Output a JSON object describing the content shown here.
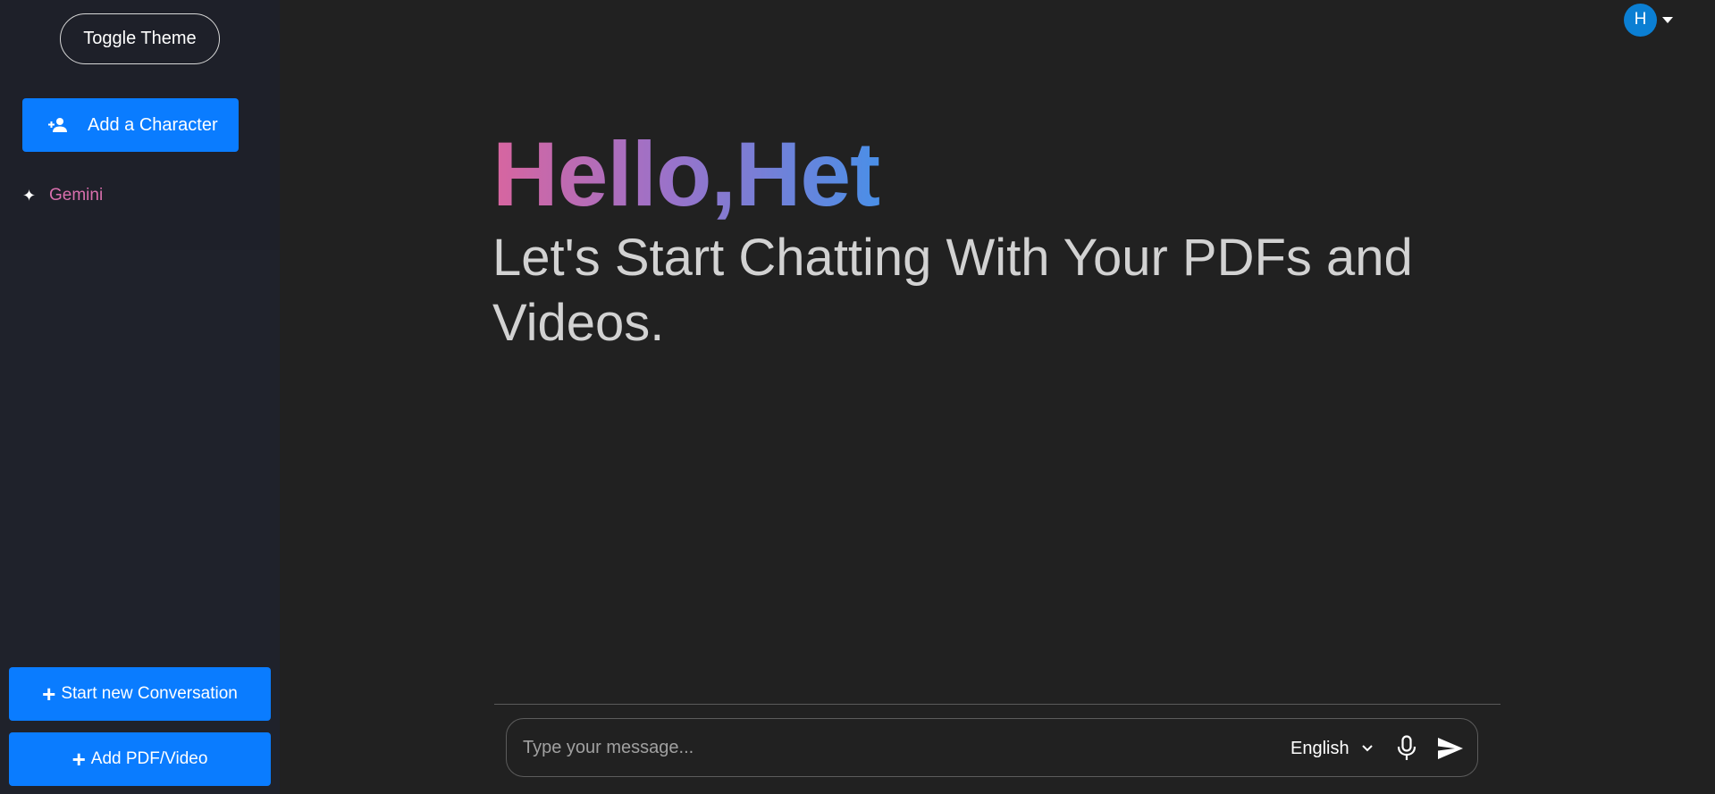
{
  "sidebar": {
    "toggle_theme_label": "Toggle Theme",
    "add_character_label": "Add a Character",
    "characters": [
      {
        "label": "Gemini",
        "icon": "sparkle-icon"
      }
    ],
    "start_conversation_label": "Start new Conversation",
    "add_pdf_label": "Add PDF/Video"
  },
  "header": {
    "avatar_initial": "H"
  },
  "main": {
    "greeting": "Hello,Het",
    "subtitle": "Let's Start Chatting With Your PDFs and Videos."
  },
  "chat": {
    "placeholder": "Type your message...",
    "value": "",
    "language": "English"
  },
  "colors": {
    "accent": "#0a7cff",
    "background": "#212121",
    "sidebar": "#1f222b",
    "gradient_start": "#d8659f",
    "gradient_end": "#4a8fe7",
    "character_label": "#d96fad"
  }
}
